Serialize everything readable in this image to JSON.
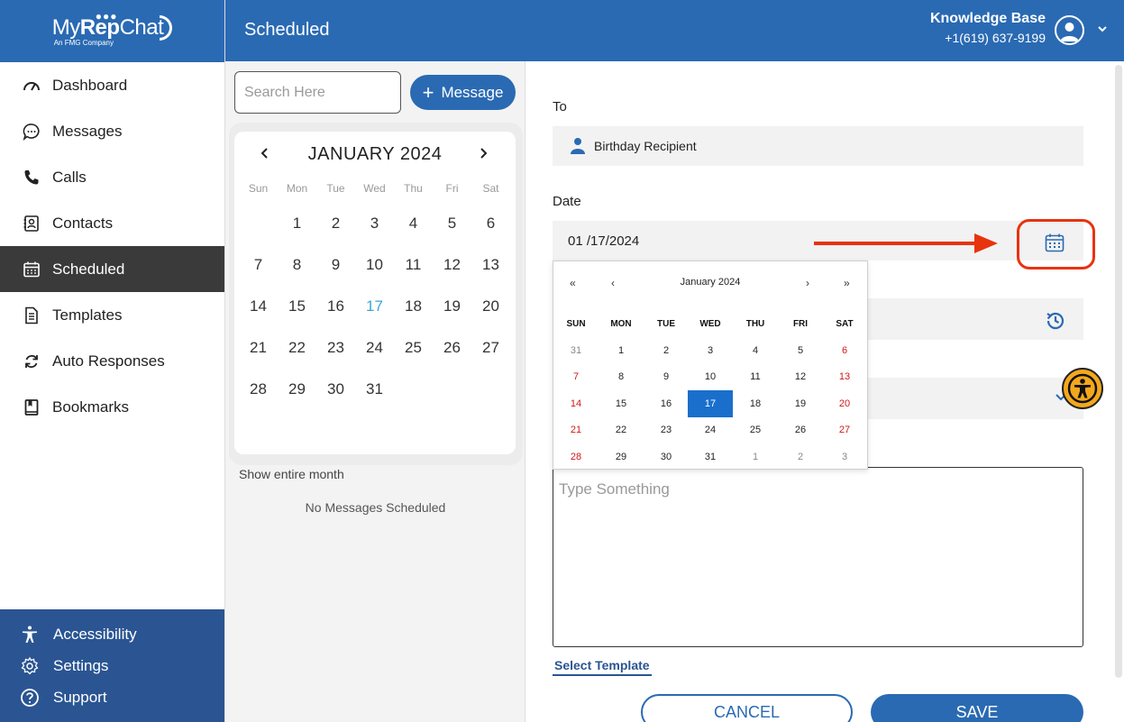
{
  "brand": {
    "logo_text_a": "My",
    "logo_text_b": "Rep",
    "logo_text_c": "Chat",
    "logo_sub": "An FMG Company"
  },
  "header": {
    "title": "Scheduled",
    "account_name": "Knowledge Base",
    "account_phone": "+1(619) 637-9199"
  },
  "nav": [
    {
      "label": "Dashboard",
      "icon": "gauge-icon"
    },
    {
      "label": "Messages",
      "icon": "chat-bubble-icon"
    },
    {
      "label": "Calls",
      "icon": "phone-icon"
    },
    {
      "label": "Contacts",
      "icon": "contact-card-icon"
    },
    {
      "label": "Scheduled",
      "icon": "calendar-icon",
      "active": true
    },
    {
      "label": "Templates",
      "icon": "document-icon"
    },
    {
      "label": "Auto Responses",
      "icon": "refresh-icon"
    },
    {
      "label": "Bookmarks",
      "icon": "bookmark-icon"
    }
  ],
  "footer": [
    {
      "label": "Accessibility",
      "icon": "accessibility-icon"
    },
    {
      "label": "Settings",
      "icon": "gear-icon"
    },
    {
      "label": "Support",
      "icon": "help-icon"
    }
  ],
  "middle": {
    "search_placeholder": "Search Here",
    "message_button": "Message",
    "calendar_title": "JANUARY 2024",
    "weekdays": [
      "Sun",
      "Mon",
      "Tue",
      "Wed",
      "Thu",
      "Fri",
      "Sat"
    ],
    "today": 17,
    "show_month": "Show entire month",
    "no_messages": "No Messages Scheduled"
  },
  "form": {
    "to_label": "To",
    "recipient": "Birthday Recipient",
    "date_label": "Date",
    "date_value": "01 /17/2024",
    "message_placeholder": "Type Something",
    "select_template": "Select Template",
    "cancel": "CANCEL",
    "save": "SAVE"
  },
  "picker": {
    "title": "January 2024",
    "prev_year": "«",
    "prev_month": "‹",
    "next_month": "›",
    "next_year": "»",
    "weekdays": [
      "SUN",
      "MON",
      "TUE",
      "WED",
      "THU",
      "FRI",
      "SAT"
    ],
    "weeks": [
      [
        "31",
        "1",
        "2",
        "3",
        "4",
        "5",
        "6"
      ],
      [
        "7",
        "8",
        "9",
        "10",
        "11",
        "12",
        "13"
      ],
      [
        "14",
        "15",
        "16",
        "17",
        "18",
        "19",
        "20"
      ],
      [
        "21",
        "22",
        "23",
        "24",
        "25",
        "26",
        "27"
      ],
      [
        "28",
        "29",
        "30",
        "31",
        "1",
        "2",
        "3"
      ]
    ],
    "selected": "17"
  },
  "colors": {
    "brand_blue": "#2a6ab3",
    "footer_blue": "#2a5592",
    "highlight_red": "#e8330f",
    "selected_blue": "#1a6fcc",
    "weekend_red": "#d01818"
  }
}
